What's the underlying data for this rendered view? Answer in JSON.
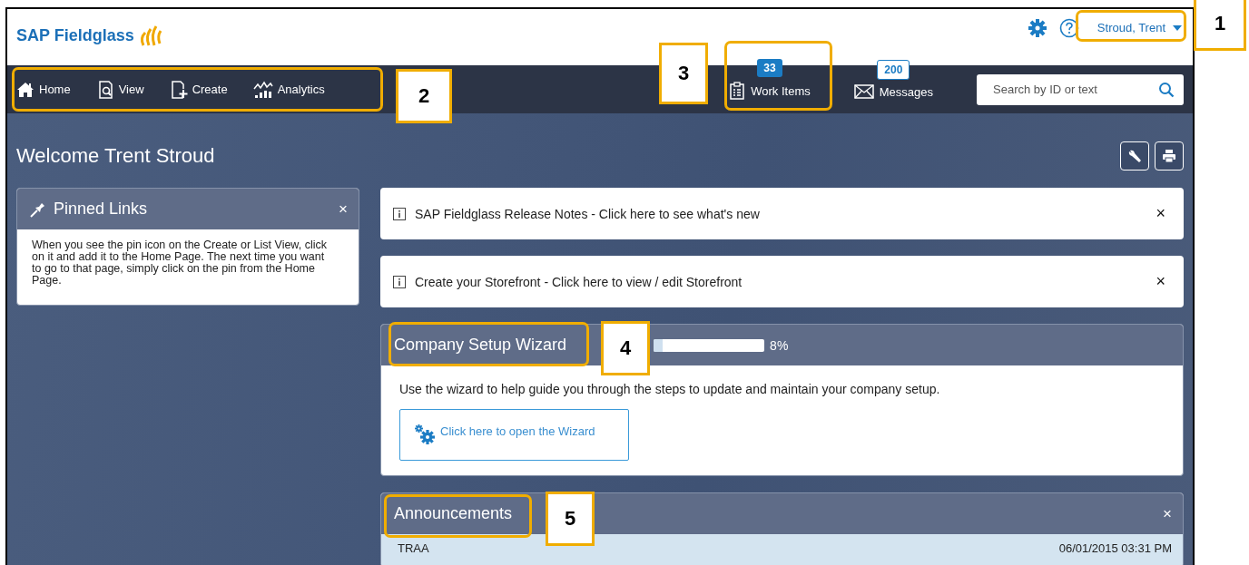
{
  "header": {
    "logo": "SAP Fieldglass",
    "user": "Stroud, Trent"
  },
  "nav": {
    "items": [
      {
        "label": "Home",
        "kind": "home"
      },
      {
        "label": "View",
        "kind": "view"
      },
      {
        "label": "Create",
        "kind": "create"
      },
      {
        "label": "Analytics",
        "kind": "analytics"
      }
    ],
    "work_items": {
      "label": "Work Items",
      "badge": "33"
    },
    "messages": {
      "label": "Messages",
      "badge": "200"
    },
    "search": {
      "placeholder": "Search by ID or text"
    }
  },
  "welcome": "Welcome Trent Stroud",
  "pinned_links": {
    "title": "Pinned Links",
    "close": "×",
    "text": "When you see the pin icon on the Create or List View, click on it and add it to the Home Page. The next time you want to go to that page, simply click on the pin from the Home Page."
  },
  "notices": [
    {
      "text": "SAP Fieldglass Release Notes - Click here to see what's new",
      "close": "×"
    },
    {
      "text": "Create your Storefront - Click here to view / edit Storefront",
      "close": "×"
    }
  ],
  "wizard": {
    "title": "Company Setup Wizard",
    "level": 0.08,
    "reading": "8%",
    "text": "Use the wizard to help guide you through the steps to update and maintain your company setup.",
    "button": "Click here to open the Wizard"
  },
  "announcements": {
    "title": "Announcements",
    "close": "×",
    "rows": [
      {
        "title": "TRAA",
        "date": "06/01/2015 03:31 PM"
      }
    ]
  },
  "callouts": [
    {
      "number": "1"
    },
    {
      "number": "2"
    },
    {
      "number": "3"
    },
    {
      "number": "4"
    },
    {
      "number": "5"
    }
  ]
}
